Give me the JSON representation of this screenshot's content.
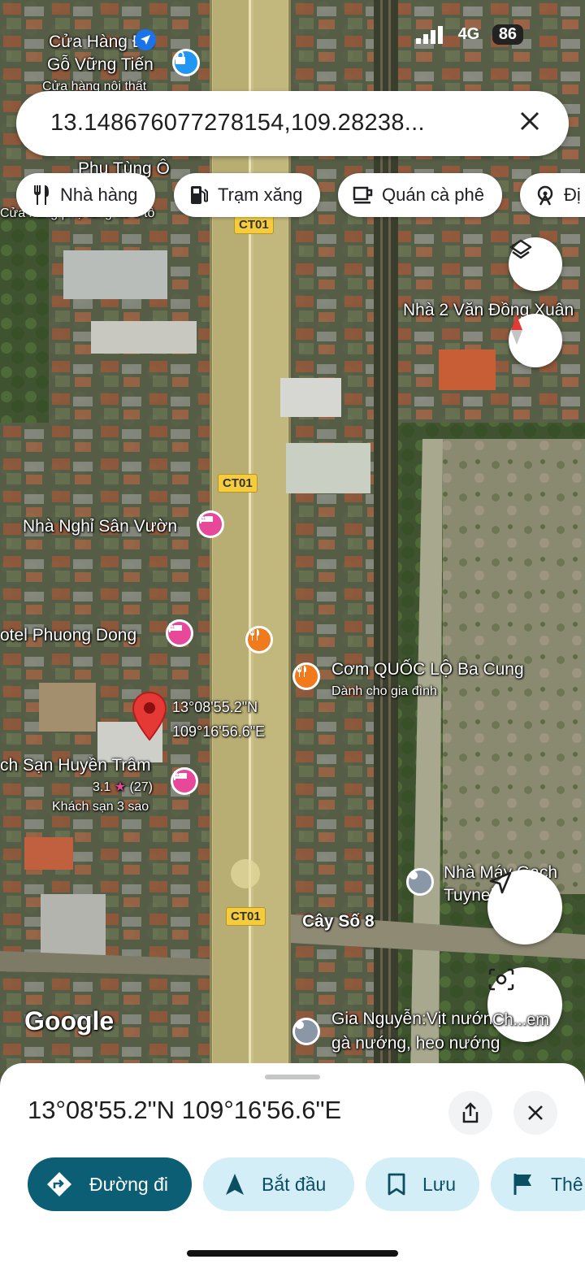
{
  "status_bar": {
    "time": "",
    "signal_label": "4G",
    "battery": "86"
  },
  "search": {
    "query": "13.148676077278154,109.28238..."
  },
  "chips": [
    {
      "label": "Nhà hàng",
      "icon": "restaurant-icon"
    },
    {
      "label": "Trạm xăng",
      "icon": "gas-station-icon"
    },
    {
      "label": "Quán cà phê",
      "icon": "coffee-icon"
    },
    {
      "label": "Đị",
      "icon": "attraction-icon"
    }
  ],
  "map": {
    "road_shields": [
      "CT01",
      "CT01",
      "CT01"
    ],
    "labels": {
      "store_name_1": "Cửa Hàng Đồ",
      "store_name_2": "Gỗ Vững Tiến",
      "store_sub": "Cửa hàng nội thất",
      "parts_1": "Phụ Tùng Ô",
      "parts_2": "Cửa hàng phụ tùng xe ô tô",
      "house": "Nhà 2 Văn Đồng Xuân",
      "guesthouse": "Nhà Nghỉ Sân Vườn",
      "hotel_pd": "otel Phuong Dong",
      "restaurant_name": "Cơm QUỐC LỘ Ba Cung",
      "restaurant_sub": "Dành cho gia đình",
      "pin_lat": "13°08'55.2\"N",
      "pin_lng": "109°16'56.6\"E",
      "hotel_ht": "ch Sạn Huyền Trâm",
      "hotel_rating": "3.1",
      "hotel_reviews": "(27)",
      "hotel_class": "Khách sạn 3 sao",
      "factory_1": "Nhà Máy Gạch",
      "factory_2": "Tuynel",
      "km_marker": "Cây Số 8",
      "bbq_1": "Gia Nguyễn:Vịt nướng",
      "bbq_2": "gà nướng, heo nướng",
      "google": "Google",
      "lens_label": "Ch...em"
    }
  },
  "sheet": {
    "coords": "13°08'55.2\"N 109°16'56.6\"E",
    "buttons": {
      "directions": "Đường đi",
      "start": "Bắt đầu",
      "save": "Lưu",
      "more": "Thê"
    }
  },
  "colors": {
    "primary": "#0b5e74",
    "secondary": "#d3eef7",
    "pin": "#e53935",
    "hotel": "#e8489a",
    "food": "#f07a1c"
  }
}
